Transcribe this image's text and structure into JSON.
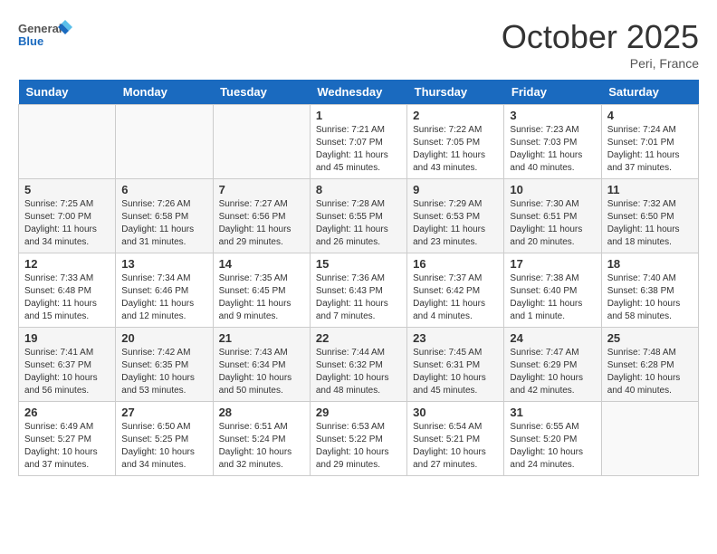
{
  "header": {
    "logo_line1": "General",
    "logo_line2": "Blue",
    "month": "October 2025",
    "location": "Peri, France"
  },
  "days_of_week": [
    "Sunday",
    "Monday",
    "Tuesday",
    "Wednesday",
    "Thursday",
    "Friday",
    "Saturday"
  ],
  "weeks": [
    [
      {
        "day": "",
        "info": ""
      },
      {
        "day": "",
        "info": ""
      },
      {
        "day": "",
        "info": ""
      },
      {
        "day": "1",
        "info": "Sunrise: 7:21 AM\nSunset: 7:07 PM\nDaylight: 11 hours and 45 minutes."
      },
      {
        "day": "2",
        "info": "Sunrise: 7:22 AM\nSunset: 7:05 PM\nDaylight: 11 hours and 43 minutes."
      },
      {
        "day": "3",
        "info": "Sunrise: 7:23 AM\nSunset: 7:03 PM\nDaylight: 11 hours and 40 minutes."
      },
      {
        "day": "4",
        "info": "Sunrise: 7:24 AM\nSunset: 7:01 PM\nDaylight: 11 hours and 37 minutes."
      }
    ],
    [
      {
        "day": "5",
        "info": "Sunrise: 7:25 AM\nSunset: 7:00 PM\nDaylight: 11 hours and 34 minutes."
      },
      {
        "day": "6",
        "info": "Sunrise: 7:26 AM\nSunset: 6:58 PM\nDaylight: 11 hours and 31 minutes."
      },
      {
        "day": "7",
        "info": "Sunrise: 7:27 AM\nSunset: 6:56 PM\nDaylight: 11 hours and 29 minutes."
      },
      {
        "day": "8",
        "info": "Sunrise: 7:28 AM\nSunset: 6:55 PM\nDaylight: 11 hours and 26 minutes."
      },
      {
        "day": "9",
        "info": "Sunrise: 7:29 AM\nSunset: 6:53 PM\nDaylight: 11 hours and 23 minutes."
      },
      {
        "day": "10",
        "info": "Sunrise: 7:30 AM\nSunset: 6:51 PM\nDaylight: 11 hours and 20 minutes."
      },
      {
        "day": "11",
        "info": "Sunrise: 7:32 AM\nSunset: 6:50 PM\nDaylight: 11 hours and 18 minutes."
      }
    ],
    [
      {
        "day": "12",
        "info": "Sunrise: 7:33 AM\nSunset: 6:48 PM\nDaylight: 11 hours and 15 minutes."
      },
      {
        "day": "13",
        "info": "Sunrise: 7:34 AM\nSunset: 6:46 PM\nDaylight: 11 hours and 12 minutes."
      },
      {
        "day": "14",
        "info": "Sunrise: 7:35 AM\nSunset: 6:45 PM\nDaylight: 11 hours and 9 minutes."
      },
      {
        "day": "15",
        "info": "Sunrise: 7:36 AM\nSunset: 6:43 PM\nDaylight: 11 hours and 7 minutes."
      },
      {
        "day": "16",
        "info": "Sunrise: 7:37 AM\nSunset: 6:42 PM\nDaylight: 11 hours and 4 minutes."
      },
      {
        "day": "17",
        "info": "Sunrise: 7:38 AM\nSunset: 6:40 PM\nDaylight: 11 hours and 1 minute."
      },
      {
        "day": "18",
        "info": "Sunrise: 7:40 AM\nSunset: 6:38 PM\nDaylight: 10 hours and 58 minutes."
      }
    ],
    [
      {
        "day": "19",
        "info": "Sunrise: 7:41 AM\nSunset: 6:37 PM\nDaylight: 10 hours and 56 minutes."
      },
      {
        "day": "20",
        "info": "Sunrise: 7:42 AM\nSunset: 6:35 PM\nDaylight: 10 hours and 53 minutes."
      },
      {
        "day": "21",
        "info": "Sunrise: 7:43 AM\nSunset: 6:34 PM\nDaylight: 10 hours and 50 minutes."
      },
      {
        "day": "22",
        "info": "Sunrise: 7:44 AM\nSunset: 6:32 PM\nDaylight: 10 hours and 48 minutes."
      },
      {
        "day": "23",
        "info": "Sunrise: 7:45 AM\nSunset: 6:31 PM\nDaylight: 10 hours and 45 minutes."
      },
      {
        "day": "24",
        "info": "Sunrise: 7:47 AM\nSunset: 6:29 PM\nDaylight: 10 hours and 42 minutes."
      },
      {
        "day": "25",
        "info": "Sunrise: 7:48 AM\nSunset: 6:28 PM\nDaylight: 10 hours and 40 minutes."
      }
    ],
    [
      {
        "day": "26",
        "info": "Sunrise: 6:49 AM\nSunset: 5:27 PM\nDaylight: 10 hours and 37 minutes."
      },
      {
        "day": "27",
        "info": "Sunrise: 6:50 AM\nSunset: 5:25 PM\nDaylight: 10 hours and 34 minutes."
      },
      {
        "day": "28",
        "info": "Sunrise: 6:51 AM\nSunset: 5:24 PM\nDaylight: 10 hours and 32 minutes."
      },
      {
        "day": "29",
        "info": "Sunrise: 6:53 AM\nSunset: 5:22 PM\nDaylight: 10 hours and 29 minutes."
      },
      {
        "day": "30",
        "info": "Sunrise: 6:54 AM\nSunset: 5:21 PM\nDaylight: 10 hours and 27 minutes."
      },
      {
        "day": "31",
        "info": "Sunrise: 6:55 AM\nSunset: 5:20 PM\nDaylight: 10 hours and 24 minutes."
      },
      {
        "day": "",
        "info": ""
      }
    ]
  ]
}
